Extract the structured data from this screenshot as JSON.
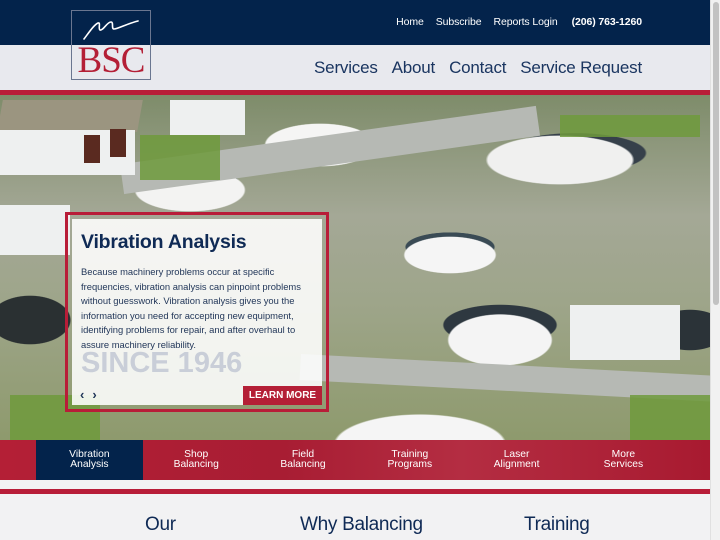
{
  "header": {
    "top_links": [
      "Home",
      "Subscribe",
      "Reports Login"
    ],
    "phone": "(206) 763-1260",
    "logo_text": "BSC",
    "main_nav": [
      "Services",
      "About",
      "Contact",
      "Service Request"
    ]
  },
  "hero": {
    "title": "Vibration Analysis",
    "description": "Because machinery problems occur at specific frequencies, vibration analysis can pinpoint problems without guesswork. Vibration analysis gives you the information you need for accepting new equipment, identifying problems for repair, and after overhaul to assure machinery reliability.",
    "watermark": "SINCE 1946",
    "prev_label": "‹",
    "next_label": "›",
    "cta_label": "LEARN MORE"
  },
  "services": {
    "active_index": 0,
    "items": [
      {
        "line1": "Vibration",
        "line2": "Analysis"
      },
      {
        "line1": "Shop",
        "line2": "Balancing"
      },
      {
        "line1": "Field",
        "line2": "Balancing"
      },
      {
        "line1": "Training",
        "line2": "Programs"
      },
      {
        "line1": "Laser",
        "line2": "Alignment"
      },
      {
        "line1": "More",
        "line2": "Services"
      }
    ]
  },
  "section_titles": [
    "Our",
    "Why Balancing",
    "Training"
  ],
  "colors": {
    "navy": "#03234b",
    "brand_red": "#b41f36",
    "nav_bg": "#e8e9ee",
    "page_bg": "#f2f2f3"
  }
}
